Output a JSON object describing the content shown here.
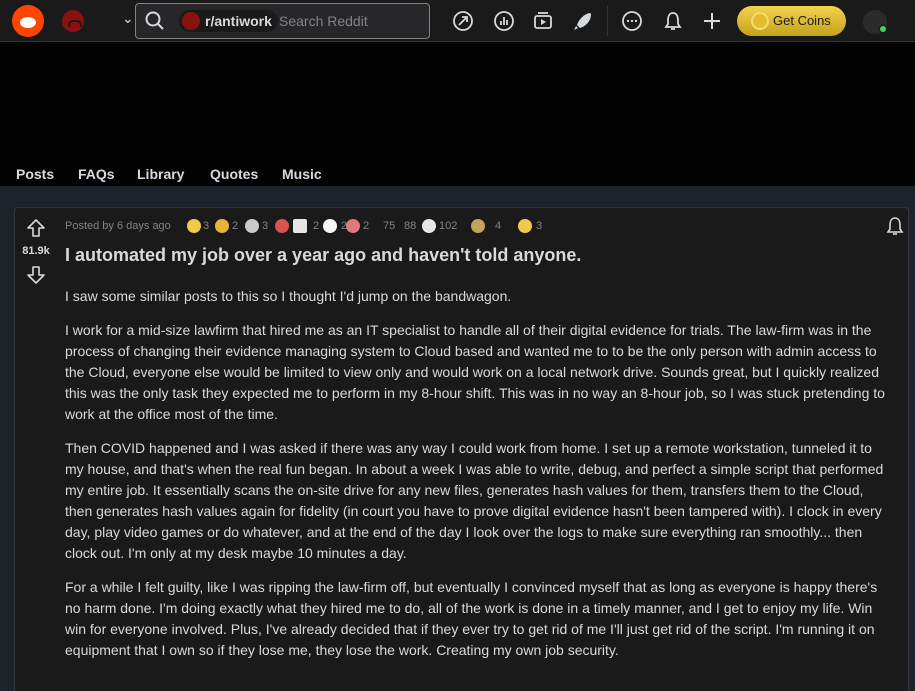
{
  "header": {
    "community": "r/antiwork",
    "search_placeholder": "Search Reddit",
    "coins_label": "Get Coins",
    "icons": [
      "reddit-logo",
      "popular-icon",
      "stats-icon",
      "video-icon",
      "rocket-icon",
      "chat-icon",
      "bell-icon",
      "plus-icon"
    ]
  },
  "nav": {
    "tabs": [
      "Posts",
      "FAQs",
      "Library",
      "Quotes",
      "Music"
    ]
  },
  "post": {
    "score": "81.9k",
    "posted_by": "Posted by 6 days ago",
    "awards": [
      "3",
      "2",
      "3",
      "2",
      "2",
      "75",
      "88",
      "102",
      "4",
      "3"
    ],
    "title": "I automated my job over a year ago and haven't told anyone.",
    "paragraphs": [
      "I saw some similar posts to this so I thought I'd jump on the bandwagon.",
      "I work for a mid-size lawfirm that hired me as an IT specialist to handle all of their digital evidence for trials. The law-firm was in the process of changing their evidence managing system to Cloud based and wanted me to to be the only person with admin access to the Cloud, everyone else would be limited to view only and would work on a local network drive. Sounds great, but I quickly realized this was the only task they expected me to perform in my 8-hour shift. This was in no way an 8-hour job, so I was stuck pretending to work at the office most of the time.",
      "Then COVID happened and I was asked if there was any way I could work from home. I set up a remote workstation, tunneled it to my house, and that's when the real fun began. In about a week I was able to write, debug, and perfect a simple script that performed my entire job. It essentially scans the on-site drive for any new files, generates hash values for them, transfers them to the Cloud, then generates hash values again for fidelity (in court you have to prove digital evidence hasn't been tampered with). I clock in every day, play video games or do whatever, and at the end of the day I look over the logs to make sure everything ran smoothly... then clock out. I'm only at my desk maybe 10 minutes a day.",
      "For a while I felt guilty, like I was ripping the law-firm off, but eventually I convinced myself that as long as everyone is happy there's no harm done. I'm doing exactly what they hired me to do, all of the work is done in a timely manner, and I get to enjoy my life. Win win for everyone involved. Plus, I've already decided that if they ever try to get rid of me I'll just get rid of the script. I'm running it on equipment that I own so if they lose me, they lose the work. Creating my own job security."
    ]
  },
  "colors": {
    "accent": "#ff4500",
    "coins": "#e6bb2e",
    "online": "#46d160",
    "community": "#8b1111"
  }
}
